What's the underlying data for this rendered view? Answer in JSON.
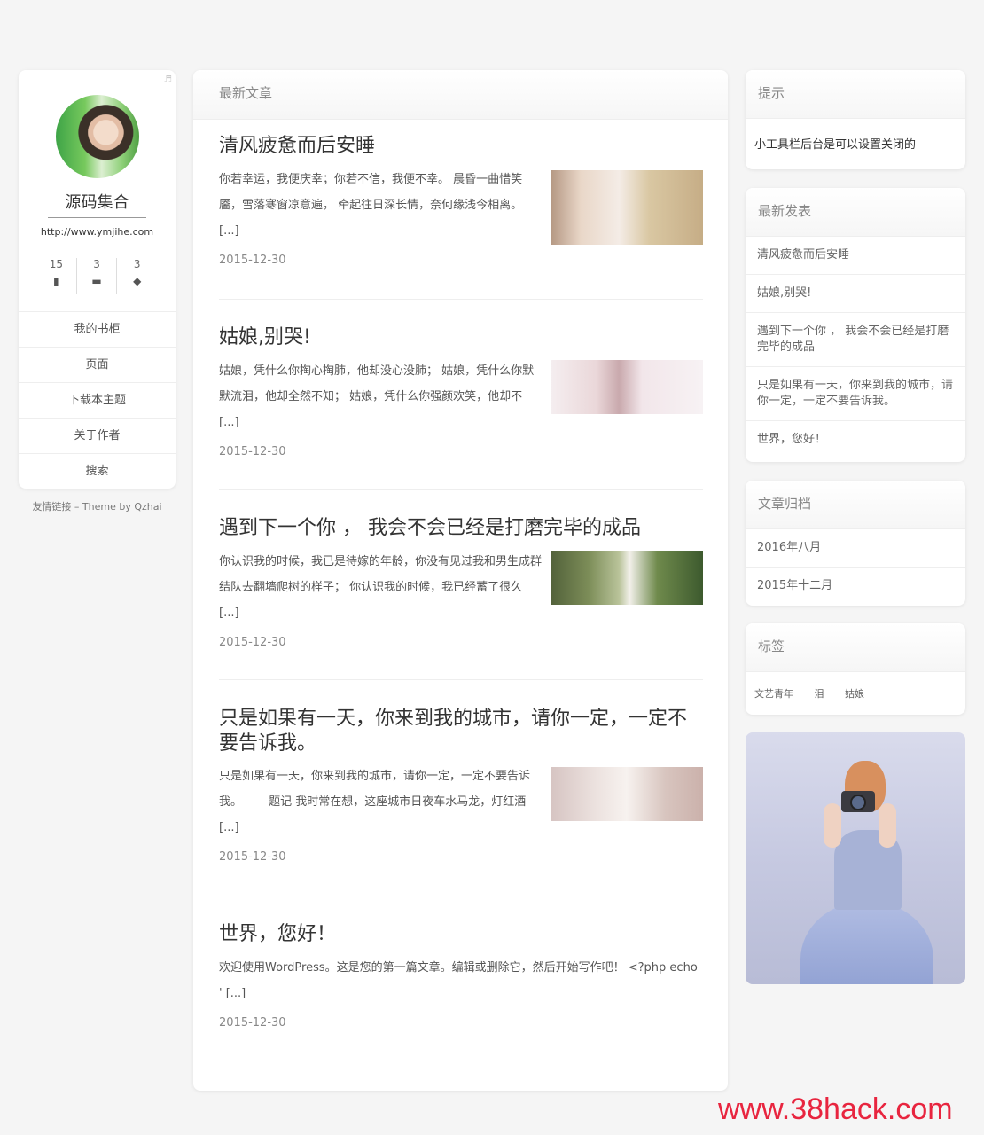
{
  "profile": {
    "site_title": "源码集合",
    "site_url": "http://www.ymjihe.com",
    "stats": [
      {
        "value": "15",
        "icon": "document-icon",
        "glyph": "▮"
      },
      {
        "value": "3",
        "icon": "folder-icon",
        "glyph": "▬"
      },
      {
        "value": "3",
        "icon": "tags-icon",
        "glyph": "◆"
      }
    ],
    "music_icon": "♬",
    "menu": [
      "我的书柜",
      "页面",
      "下载本主题",
      "关于作者",
      "搜索"
    ]
  },
  "footer_credit": "友情链接 – Theme by Qzhai",
  "main": {
    "heading": "最新文章",
    "posts": [
      {
        "title": "清风疲惫而后安睡",
        "excerpt": "你若幸运，我便庆幸；你若不信，我便不幸。 晨昏一曲惜笑靥，雪落寒窗凉意遍， 牵起往日深长情，奈何缘浅今相离。 [...]",
        "date": "2015-12-30"
      },
      {
        "title": "姑娘,别哭!",
        "excerpt": "姑娘，凭什么你掏心掏肺，他却没心没肺； 姑娘，凭什么你默默流泪，他却全然不知； 姑娘，凭什么你强颜欢笑，他却不 [...]",
        "date": "2015-12-30"
      },
      {
        "title": "遇到下一个你 ， 我会不会已经是打磨完毕的成品",
        "excerpt": "你认识我的时候，我已是待嫁的年龄，你没有见过我和男生成群结队去翻墙爬树的样子； 你认识我的时候，我已经蓄了很久 [...]",
        "date": "2015-12-30"
      },
      {
        "title": "只是如果有一天，你来到我的城市，请你一定，一定不要告诉我。",
        "excerpt": "只是如果有一天，你来到我的城市，请你一定，一定不要告诉我。 ——题记 我时常在想，这座城市日夜车水马龙，灯红酒 [...]",
        "date": "2015-12-30"
      },
      {
        "title": "世界，您好！",
        "excerpt": "欢迎使用WordPress。这是您的第一篇文章。编辑或删除它，然后开始写作吧！ <?php echo ' [...]",
        "date": "2015-12-30"
      }
    ]
  },
  "sidebar": {
    "tip": {
      "heading": "提示",
      "text": "小工具栏后台是可以设置关闭的"
    },
    "recent": {
      "heading": "最新发表",
      "items": [
        "清风疲惫而后安睡",
        "姑娘,别哭!",
        "遇到下一个你 ， 我会不会已经是打磨完毕的成品",
        "只是如果有一天，你来到我的城市，请你一定，一定不要告诉我。",
        "世界，您好！"
      ]
    },
    "archive": {
      "heading": "文章归档",
      "items": [
        "2016年八月",
        "2015年十二月"
      ]
    },
    "tags": {
      "heading": "标签",
      "items": [
        "文艺青年",
        "泪",
        "姑娘"
      ]
    }
  },
  "watermark": "www.38hack.com"
}
